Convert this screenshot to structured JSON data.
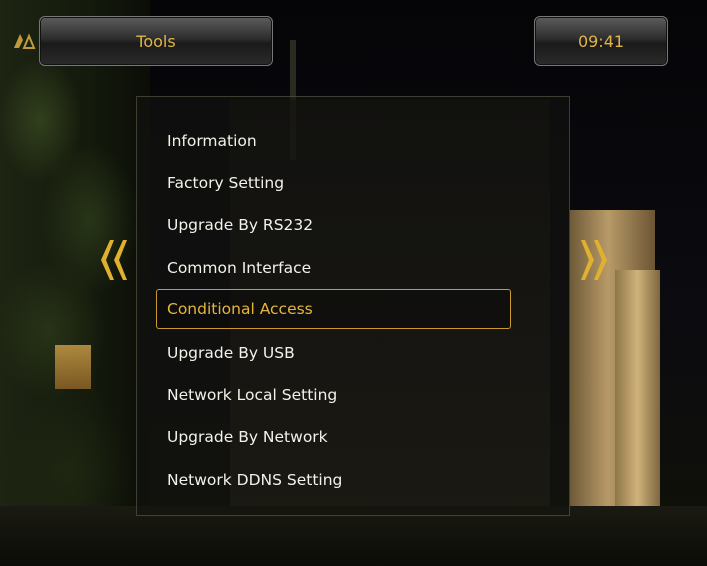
{
  "header": {
    "title": "Tools",
    "clock": "09:41"
  },
  "menu": {
    "items": [
      {
        "label": "Information",
        "selected": false
      },
      {
        "label": "Factory Setting",
        "selected": false
      },
      {
        "label": "Upgrade By RS232",
        "selected": false
      },
      {
        "label": "Common Interface",
        "selected": false
      },
      {
        "label": "Conditional Access",
        "selected": true
      },
      {
        "label": "Upgrade By USB",
        "selected": false
      },
      {
        "label": "Network Local Setting",
        "selected": false
      },
      {
        "label": "Upgrade By Network",
        "selected": false
      },
      {
        "label": "Network DDNS Setting",
        "selected": false
      }
    ]
  },
  "icons": {
    "left_nav": "double-chevron-left-icon",
    "right_nav": "double-chevron-right-icon",
    "logo": "receiver-logo-icon"
  },
  "colors": {
    "accent": "#e0b545",
    "selection_border": "#c89b2c",
    "menu_text": "#f2f2ea"
  }
}
